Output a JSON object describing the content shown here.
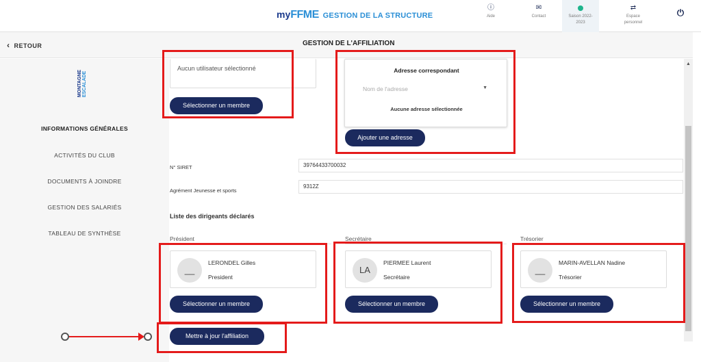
{
  "topbar": {
    "brand_my": "my",
    "brand_ffme": "FFME",
    "brand_section": "GESTION DE LA STRUCTURE",
    "buttons": [
      {
        "icon": "info-icon",
        "label": "Aide"
      },
      {
        "icon": "mail-icon",
        "label": "Contact"
      },
      {
        "icon": "status-dot-icon",
        "label_line1": "Saison 2022-",
        "label_line2": "2023"
      },
      {
        "icon": "swap-arrows-icon",
        "label_line1": "Espace",
        "label_line2": "personnel"
      }
    ],
    "power_icon": "power-icon",
    "colors": {
      "brand_dark": "#1b3a8c",
      "brand_light": "#2b8fd6",
      "season_dot": "#1eb48c"
    }
  },
  "header": {
    "back_label": "RETOUR",
    "title": "GESTION DE L'AFFILIATION"
  },
  "sidebar": {
    "logo_line1": "MONTAGNE",
    "logo_line2": "ESCALADE",
    "items": [
      {
        "label": "INFORMATIONS GÉNÉRALES",
        "active": true
      },
      {
        "label": "ACTIVITÉS DU CLUB",
        "active": false
      },
      {
        "label": "DOCUMENTS À JOINDRE",
        "active": false
      },
      {
        "label": "GESTION DES SALARIÉS",
        "active": false
      },
      {
        "label": "TABLEAU DE SYNTHÈSE",
        "active": false
      }
    ]
  },
  "main": {
    "user_card": {
      "text": "Aucun utilisateur sélectionné",
      "button": "Sélectionner un membre"
    },
    "address_card": {
      "title": "Adresse correspondant",
      "select_placeholder": "Nom de l'adresse",
      "empty_text": "Aucune adresse sélectionnée",
      "button": "Ajouter une adresse"
    },
    "siret": {
      "label": "N° SIRET",
      "value": "39764433700032"
    },
    "agrement": {
      "label": "Agrément Jeunesse et sports",
      "value": "9312Z"
    },
    "leaders": {
      "title": "Liste des dirigeants déclarés",
      "items": [
        {
          "role": "Président",
          "initials": "__",
          "name": "LERONDEL Gilles",
          "title": "President",
          "button": "Sélectionner un membre"
        },
        {
          "role": "Secrétaire",
          "initials": "LA",
          "name": "PIERMEE Laurent",
          "title": "Secrétaire",
          "button": "Sélectionner un membre"
        },
        {
          "role": "Trésorier",
          "initials": "__",
          "name": "MARIN-AVELLAN Nadine",
          "title": "Trésorier",
          "button": "Sélectionner un membre"
        }
      ]
    },
    "update_button": "Mettre à jour l'affiliation"
  },
  "colors": {
    "primary_button": "#1b2a5e",
    "highlight": "#e41a1a"
  }
}
